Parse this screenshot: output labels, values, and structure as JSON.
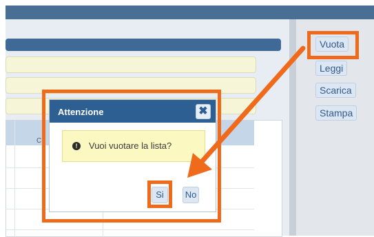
{
  "right_panel": {
    "buttons": [
      "Vuota",
      "Leggi",
      "Scarica",
      "Stampa"
    ]
  },
  "table": {
    "partial_header": "C"
  },
  "dialog": {
    "title": "Attenzione",
    "close_symbol": "✖",
    "message": "Vuoi vuotare la lista?",
    "yes_label": "Si",
    "no_label": "No"
  },
  "colors": {
    "highlight": "#f06a1c",
    "dialog_header": "#2d5f93",
    "message_bg": "#fcf8c2"
  }
}
